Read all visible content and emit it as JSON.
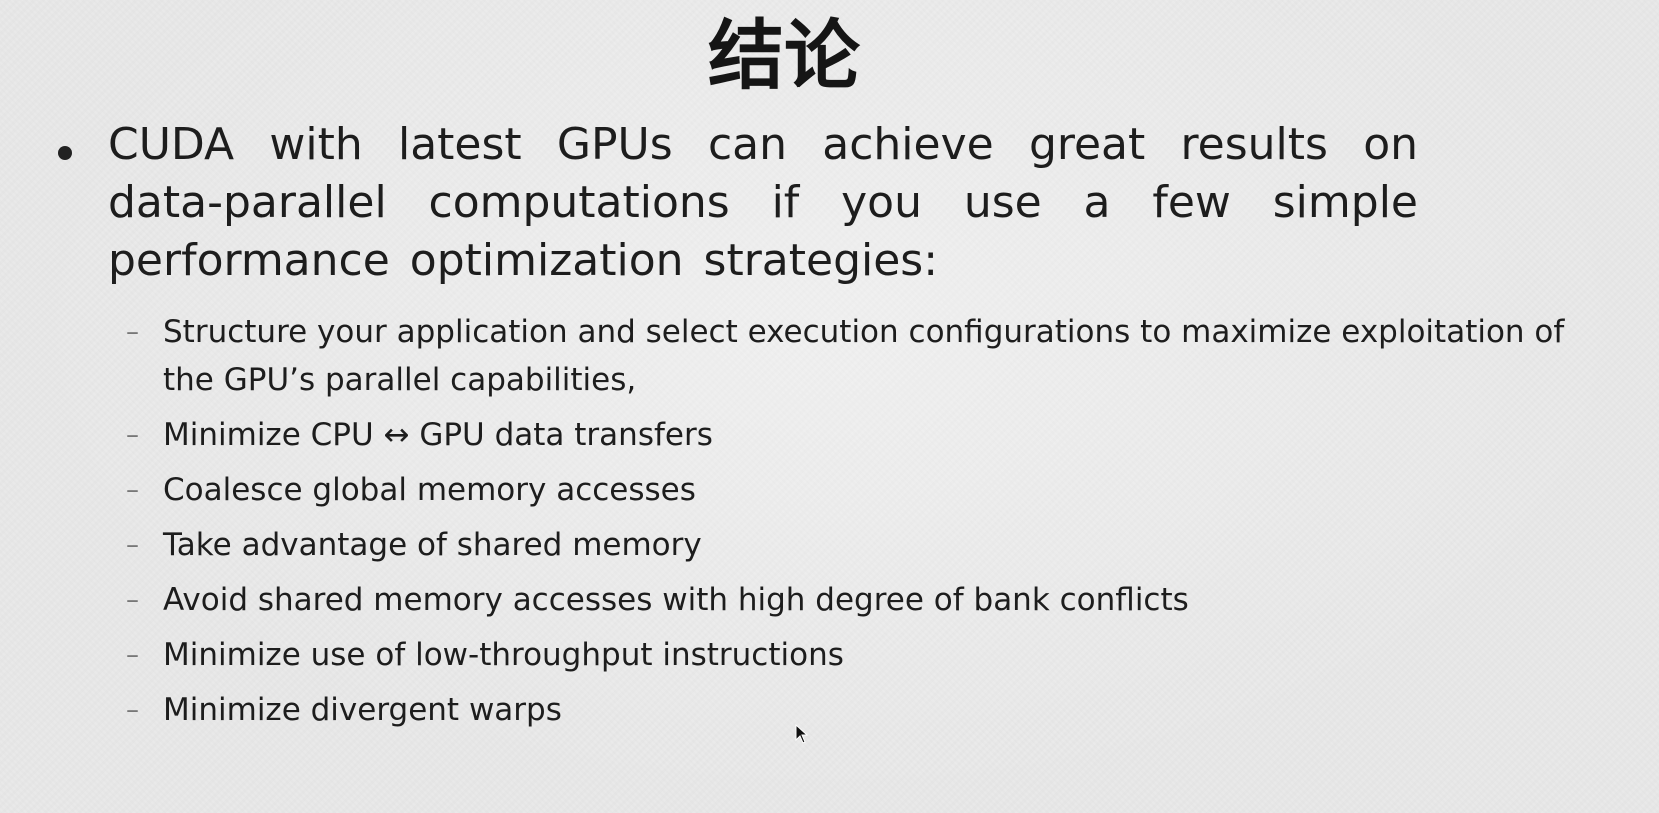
{
  "slide": {
    "title": "结论",
    "main_bullet": "CUDA with latest GPUs can achieve great results on data-parallel computations if you use a few simple performance optimization strategies:",
    "sub_bullets": [
      "Structure your application and select execution configurations  to maximize exploitation of the GPU’s parallel capabilities,",
      "Minimize CPU ↔ GPU data transfers",
      "Coalesce global memory accesses",
      "Take advantage of shared memory",
      "Avoid shared memory accesses with high degree of bank  conflicts",
      "Minimize use of low-throughput instructions",
      "Minimize divergent warps"
    ],
    "dash_glyph": "–"
  },
  "colors": {
    "background": "#e9e9e9",
    "text": "#1d1d1d"
  },
  "icons": {
    "cursor": "mouse-pointer-icon"
  }
}
